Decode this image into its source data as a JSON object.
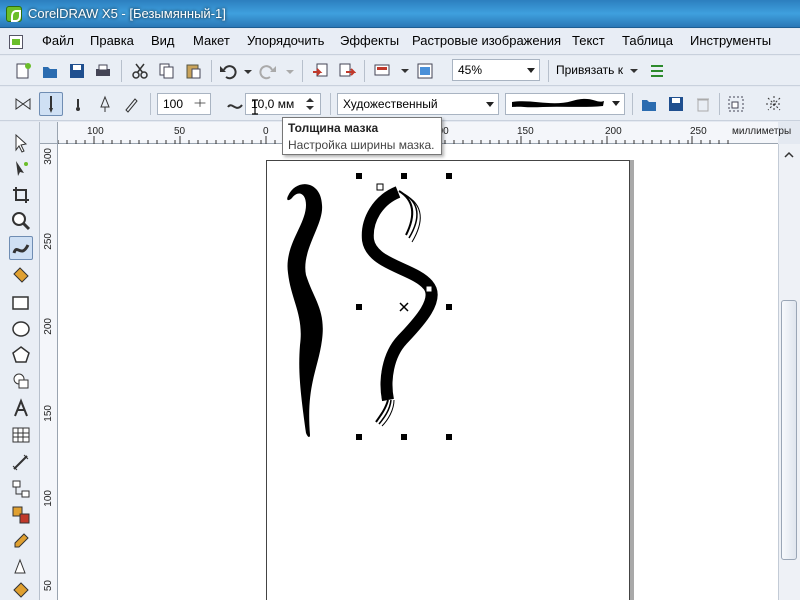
{
  "window": {
    "title": "CorelDRAW X5 - [Безымянный-1]"
  },
  "menu": [
    "Файл",
    "Правка",
    "Вид",
    "Макет",
    "Упорядочить",
    "Эффекты",
    "Растровые изображения",
    "Текст",
    "Таблица",
    "Инструменты"
  ],
  "toolbar1": {
    "zoom": "45%",
    "snap_label": "Привязать к"
  },
  "toolbar2": {
    "size_value": "100",
    "width_value": "10,0 мм",
    "brush_style": "Художественный"
  },
  "tooltip": {
    "title": "Толщина мазка",
    "text": "Настройка ширины мазка."
  },
  "ruler_h": {
    "labels": [
      "100",
      "50",
      "0",
      "50",
      "100",
      "150",
      "200",
      "250"
    ],
    "units": "миллиметры"
  },
  "ruler_v": {
    "labels": [
      "300",
      "250",
      "200",
      "150",
      "100",
      "50"
    ]
  },
  "colors": {
    "titlebar": "#3fa0de",
    "menubar": "#e8edf5",
    "canvas": "#ffffff"
  }
}
